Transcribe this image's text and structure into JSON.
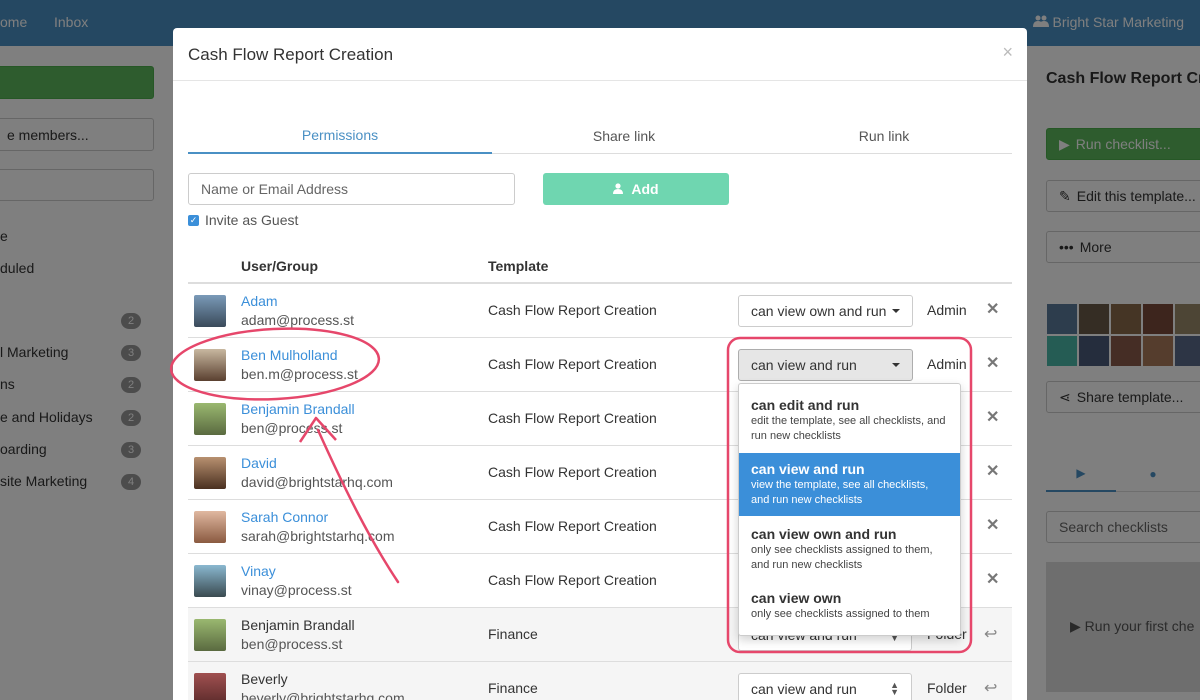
{
  "topbar": {
    "nav_home": "ome",
    "nav_inbox": "Inbox",
    "brand": "Bright Star Marketing"
  },
  "left": {
    "create_button": "",
    "members_button": "e members...",
    "items": [
      {
        "label": "e",
        "count": ""
      },
      {
        "label": "duled",
        "count": ""
      },
      {
        "label": "",
        "count": "2"
      },
      {
        "label": "l Marketing",
        "count": "3"
      },
      {
        "label": "ns",
        "count": "2"
      },
      {
        "label": "e and Holidays",
        "count": "2"
      },
      {
        "label": "oarding",
        "count": "3"
      },
      {
        "label": "site Marketing",
        "count": "4"
      }
    ]
  },
  "right": {
    "title": "Cash Flow Report Cre",
    "run_button": "Run checklist...",
    "edit_button": "Edit this template...",
    "more_button": "More",
    "share_button": "Share template...",
    "search_placeholder": "Search checklists",
    "run_first": "Run your first che"
  },
  "modal": {
    "title": "Cash Flow Report Creation",
    "close": "×",
    "tabs": [
      "Permissions",
      "Share link",
      "Run link"
    ],
    "active_tab": 0,
    "name_placeholder": "Name or Email Address",
    "add_button": "Add",
    "invite_guest": "Invite as Guest",
    "invite_guest_checked": true,
    "col_user": "User/Group",
    "col_template": "Template",
    "rows": [
      {
        "name": "Adam",
        "email": "adam@process.st",
        "template": "Cash Flow Report Creation",
        "permission": "can view own and run",
        "role": "Admin",
        "action": "remove"
      },
      {
        "name": "Ben Mulholland",
        "email": "ben.m@process.st",
        "template": "Cash Flow Report Creation",
        "permission": "can view and run",
        "role": "Admin",
        "action": "remove"
      },
      {
        "name": "Benjamin Brandall",
        "email": "ben@process.st",
        "template": "Cash Flow Report Creation",
        "permission": "",
        "role": "",
        "action": "remove"
      },
      {
        "name": "David",
        "email": "david@brightstarhq.com",
        "template": "Cash Flow Report Creation",
        "permission": "",
        "role": "t",
        "action": "remove"
      },
      {
        "name": "Sarah Connor",
        "email": "sarah@brightstarhq.com",
        "template": "Cash Flow Report Creation",
        "permission": "",
        "role": "t",
        "action": "remove"
      },
      {
        "name": "Vinay",
        "email": "vinay@process.st",
        "template": "Cash Flow Report Creation",
        "permission": "",
        "role": "n",
        "action": "remove"
      },
      {
        "name": "Benjamin Brandall",
        "email": "ben@process.st",
        "template": "Finance",
        "permission": "can view and run",
        "role": "Folder",
        "action": "undo"
      },
      {
        "name": "Beverly",
        "email": "beverly@brightstarhq.com",
        "template": "Finance",
        "permission": "can view and run",
        "role": "Folder",
        "action": "undo"
      }
    ],
    "dropdown": {
      "options": [
        {
          "title": "can edit and run",
          "desc": "edit the template, see all checklists, and run new checklists"
        },
        {
          "title": "can view and run",
          "desc": "view the template, see all checklists, and run new checklists"
        },
        {
          "title": "can view own and run",
          "desc": "only see checklists assigned to them, and run new checklists"
        },
        {
          "title": "can view own",
          "desc": "only see checklists assigned to them"
        }
      ],
      "selected": 1
    }
  },
  "colors": {
    "accent": "#3b8fd9",
    "topbar": "#4a90c4",
    "add_button": "#6fd6b0",
    "annotation": "#e6476b"
  }
}
